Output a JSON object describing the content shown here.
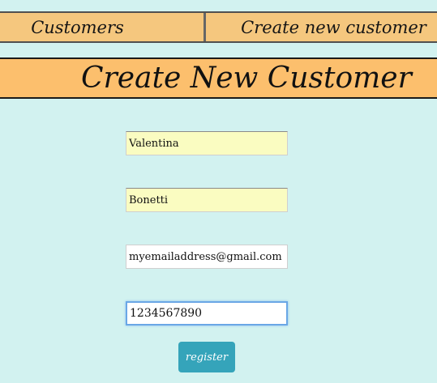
{
  "nav": {
    "customers_label": "Customers",
    "create_label": "Create new customer"
  },
  "page": {
    "title": "Create New Customer"
  },
  "form": {
    "first_name": "Valentina",
    "last_name": "Bonetti",
    "email": "myemailaddress@gmail.com",
    "phone": "1234567890",
    "register_label": "register"
  },
  "colors": {
    "background": "#d2f2f0",
    "nav": "#f5c77e",
    "title_bar": "#fcbf6d",
    "autofill": "#fafcc1",
    "button": "#35a4ba",
    "focus": "#6aa7e6"
  }
}
